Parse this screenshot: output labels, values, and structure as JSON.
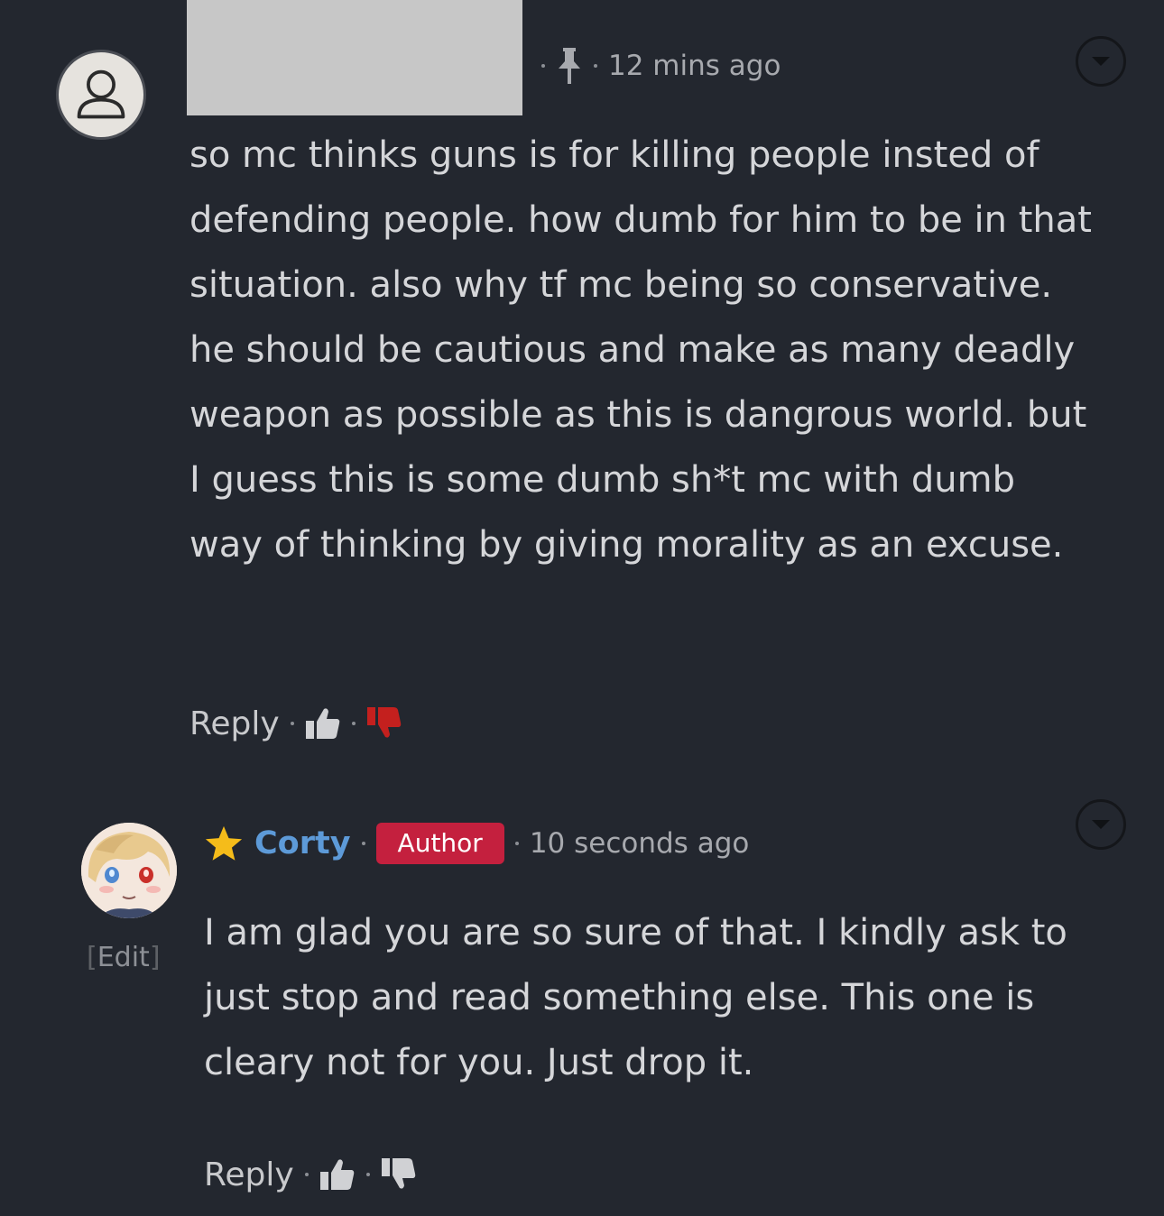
{
  "comments": [
    {
      "username": "",
      "pinned": true,
      "time": "12 mins ago",
      "text": "so mc thinks guns is for killing people insted of defending people. how dumb for him to be in that situation. also why tf mc being so conservative. he should be cautious and make as many deadly weapon as possible as this is dangrous world. but I guess this is some dumb sh*t mc with dumb way of thinking by giving morality as an excuse.",
      "reply_label": "Reply",
      "disliked": true,
      "icons": {
        "pin": "pin-icon",
        "like": "thumbs-up-icon",
        "dislike": "thumbs-down-icon",
        "menu": "chevron-down-icon"
      },
      "dislike_color": "#c4201e"
    },
    {
      "username": "Corty",
      "badge": "Author",
      "time": "10 seconds ago",
      "edit_label": "Edit",
      "text": "I am glad you are so sure of that. I kindly ask to just stop and read something else. This one is cleary not for you. Just drop it.",
      "reply_label": "Reply",
      "disliked": false,
      "icons": {
        "star": "star-icon",
        "like": "thumbs-up-icon",
        "dislike": "thumbs-down-icon",
        "menu": "chevron-down-icon"
      },
      "name_color": "#5d9ad8",
      "badge_color": "#c4203e"
    }
  ]
}
